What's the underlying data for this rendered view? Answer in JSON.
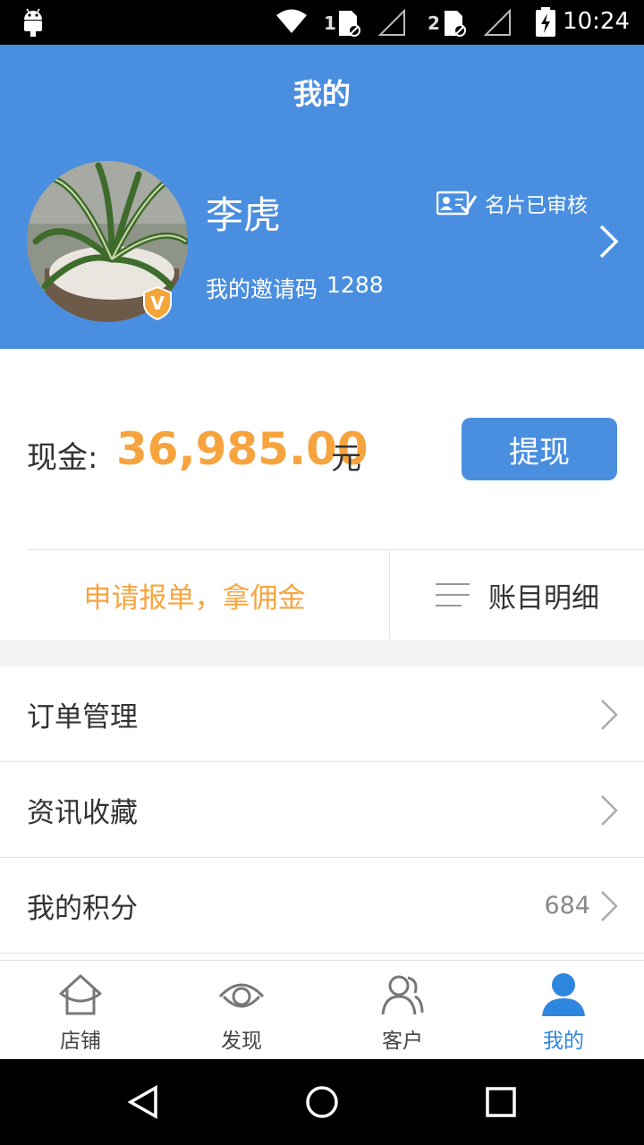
{
  "status_bar": {
    "time": "10:24",
    "sim1": "1",
    "sim2": "2",
    "icons": [
      "android-icon",
      "wifi-icon",
      "sim1-icon",
      "signal1-icon",
      "sim2-icon",
      "signal2-icon",
      "battery-charging-icon"
    ]
  },
  "header": {
    "title": "我的",
    "user_name": "李虎",
    "verified_label": "名片已审核",
    "invite_label": "我的邀请码",
    "invite_code": "1288",
    "badge_letter": "V"
  },
  "cash": {
    "label": "现金:",
    "amount": "36,985.00",
    "unit": "元",
    "withdraw_button": "提现"
  },
  "actions": {
    "apply_label": "申请报单，拿佣金",
    "ledger_label": "账目明细"
  },
  "menu": [
    {
      "label": "订单管理",
      "value": ""
    },
    {
      "label": "资讯收藏",
      "value": ""
    },
    {
      "label": "我的积分",
      "value": "684"
    }
  ],
  "tabs": [
    {
      "label": "店铺",
      "icon": "store-icon",
      "active": false
    },
    {
      "label": "发现",
      "icon": "eye-icon",
      "active": false
    },
    {
      "label": "客户",
      "icon": "customers-icon",
      "active": false
    },
    {
      "label": "我的",
      "icon": "profile-icon",
      "active": true
    }
  ],
  "colors": {
    "primary": "#4a8ee0",
    "accent_orange": "#f7a43f",
    "tab_active": "#2f86de"
  }
}
